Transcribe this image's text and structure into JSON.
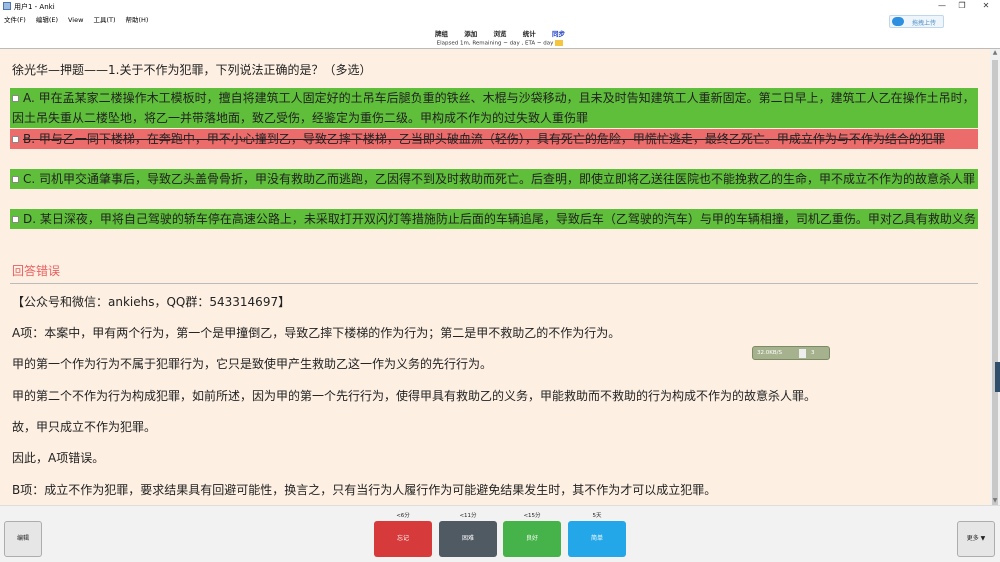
{
  "window": {
    "title": "用户1 - Anki",
    "minimize": "—",
    "maximize": "❐",
    "close": "✕"
  },
  "menu": [
    "文件(F)",
    "编辑(E)",
    "View",
    "工具(T)",
    "帮助(H)"
  ],
  "cloud_button": {
    "label": "拖拽上传",
    "color": "#2d8fe0"
  },
  "toolbar": {
    "items": [
      "牌组",
      "添加",
      "浏览",
      "统计",
      "同步"
    ],
    "active": "同步"
  },
  "status": {
    "text": "Elapsed 1m, Remaining ~ day , ETA ~ day"
  },
  "card": {
    "question": "徐光华—押题——1.关于不作为犯罪，下列说法正确的是？（多选）",
    "options": [
      {
        "text": "A. 甲在孟某家二楼操作木工模板时，擅自将建筑工人固定好的土吊车后腿负重的铁丝、木棍与沙袋移动，且未及时告知建筑工人重新固定。第二日早上，建筑工人乙在操作土吊时，因土吊失重从二楼坠地，将乙一并带落地面，致乙受伤，经鉴定为重伤二级。甲构成不作为的过失致人重伤罪",
        "state": "correct"
      },
      {
        "text": "B. 甲与乙一同下楼梯，在奔跑中，甲不小心撞到乙，导致乙摔下楼梯，乙当即头破血流（轻伤），具有死亡的危险，甲慌忙逃走，最终乙死亡。甲成立作为与不作为结合的犯罪",
        "state": "wrong"
      },
      {
        "text": "C. 司机甲交通肇事后，导致乙头盖骨骨折，甲没有救助乙而逃跑，乙因得不到及时救助而死亡。后查明，即使立即将乙送往医院也不能挽救乙的生命，甲不成立不作为的故意杀人罪",
        "state": "correct"
      },
      {
        "text": "D. 某日深夜，甲将自己驾驶的轿车停在高速公路上，未采取打开双闪灯等措施防止后面的车辆追尾，导致后车（乙驾驶的汽车）与甲的车辆相撞，司机乙重伤。甲对乙具有救助义务",
        "state": "correct"
      }
    ],
    "result": "回答错误",
    "explanation": [
      "【公众号和微信：ankiehs，QQ群：543314697】",
      "A项：本案中，甲有两个行为，第一个是甲撞倒乙，导致乙摔下楼梯的作为行为；第二是甲不救助乙的不作为行为。",
      "甲的第一个作为行为不属于犯罪行为，它只是致使甲产生救助乙这一作为义务的先行行为。",
      "甲的第二个不作为行为构成犯罪，如前所述，因为甲的第一个先行行为，使得甲具有救助乙的义务，甲能救助而不救助的行为构成不作为的故意杀人罪。",
      "故，甲只成立不作为犯罪。",
      "因此，A项错误。",
      "B项：成立不作为犯罪，要求结果具有回避可能性，换言之，只有当行为人履行作为可能避免结果发生时，其不作为才可以成立犯罪。"
    ]
  },
  "net_widget": {
    "speed": "32.0KB/S",
    "count": "3"
  },
  "bottom": {
    "edit_label": "编辑",
    "more_label": "更多 ▼",
    "answers": [
      {
        "time": "<6分",
        "label": "忘记",
        "color": "#d73a3a"
      },
      {
        "time": "<11分",
        "label": "困难",
        "color": "#505a63"
      },
      {
        "time": "<15分",
        "label": "良好",
        "color": "#46b24a"
      },
      {
        "time": "5天",
        "label": "简单",
        "color": "#23a7e8"
      }
    ]
  }
}
